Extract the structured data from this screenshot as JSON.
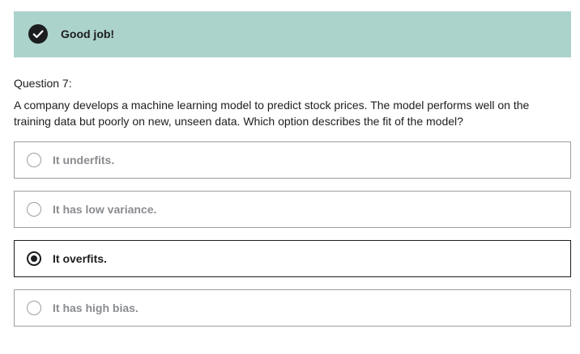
{
  "banner": {
    "icon": "check-circle-icon",
    "text": "Good job!",
    "background_color": "#acd2cc"
  },
  "question": {
    "number_label": "Question 7:",
    "text": "A company develops a machine learning model to predict stock prices. The model performs well on the training data but poorly on new, unseen data. Which option describes the fit of the model?"
  },
  "options": [
    {
      "label": "It underfits.",
      "selected": false
    },
    {
      "label": "It has low variance.",
      "selected": false
    },
    {
      "label": "It overfits.",
      "selected": true
    },
    {
      "label": "It has high bias.",
      "selected": false
    }
  ]
}
